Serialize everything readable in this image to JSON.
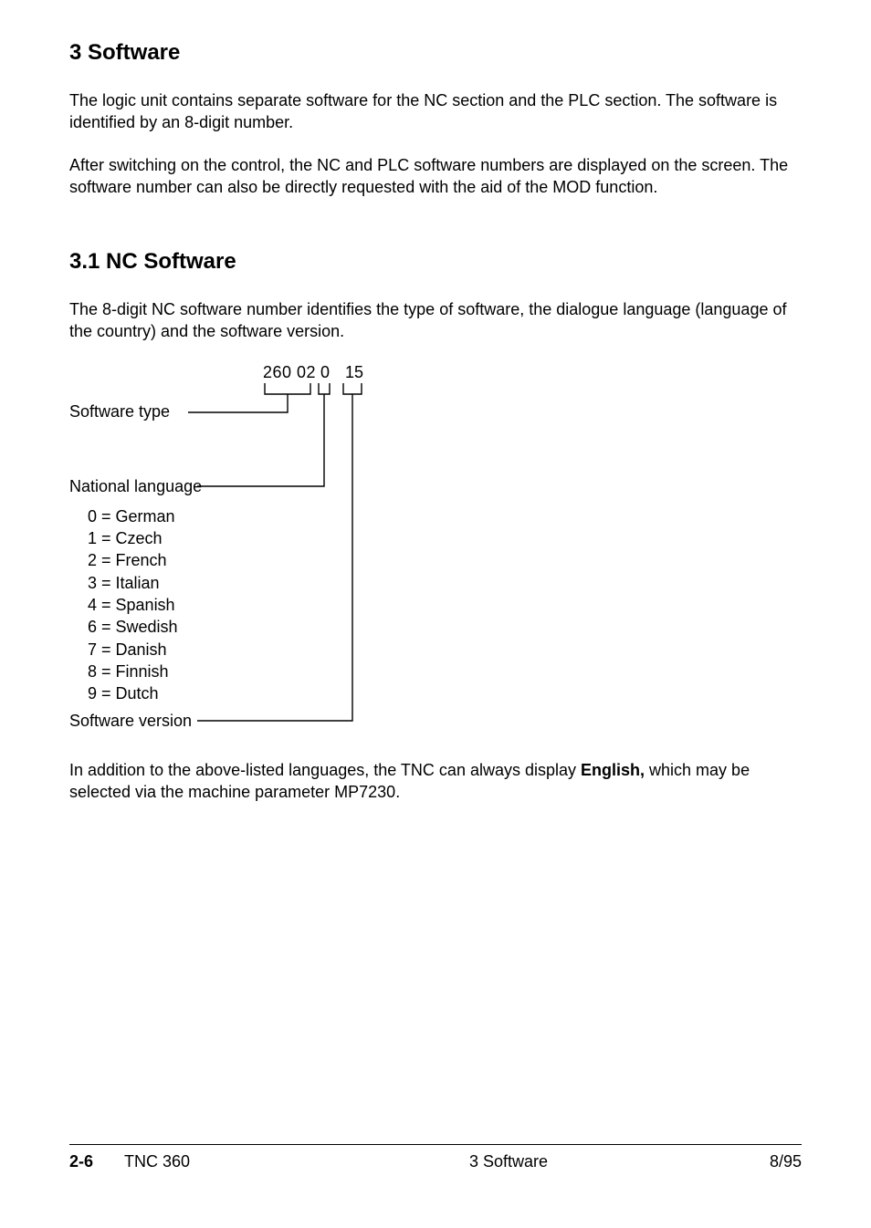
{
  "headings": {
    "h1": "3  Software",
    "h2": "3.1  NC Software"
  },
  "paragraphs": {
    "p1": "The logic unit contains separate software for the NC section and the PLC section. The software is identified by an 8-digit number.",
    "p2": "After switching on the control, the NC and PLC software numbers are displayed on the screen. The software number can also be directly requested with the aid of the MOD function.",
    "p3": "The 8-digit NC software number identifies the type of software, the dialogue language (language of the country) and the software version."
  },
  "diagram": {
    "number_parts": {
      "a": "260 02",
      "b": "0",
      "c": "15"
    },
    "labels": {
      "software_type": "Software type",
      "national_language": "National language",
      "software_version": "Software version"
    },
    "languages": [
      "0 = German",
      "1 = Czech",
      "2 = French",
      "3 = Italian",
      "4 = Spanish",
      "6 = Swedish",
      "7 = Danish",
      "8 = Finnish",
      "9 = Dutch"
    ]
  },
  "note": {
    "pre": "In addition to the above-listed languages, the TNC can always display ",
    "bold": "English,",
    "post": " which may be selected via the machine parameter MP7230."
  },
  "footer": {
    "page": "2-6",
    "model": "TNC 360",
    "section": "3  Software",
    "date": "8/95"
  }
}
